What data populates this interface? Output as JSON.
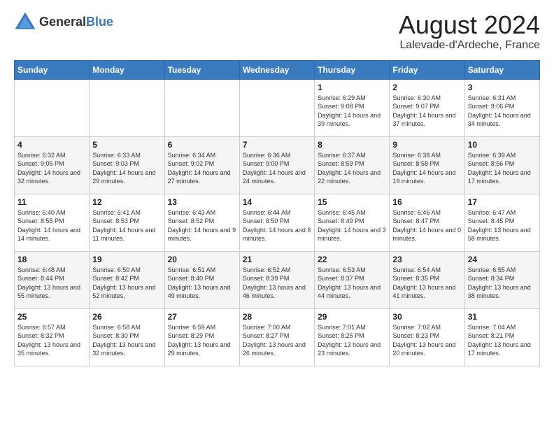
{
  "header": {
    "logo_general": "General",
    "logo_blue": "Blue",
    "month_year": "August 2024",
    "location": "Lalevade-d'Ardeche, France"
  },
  "weekdays": [
    "Sunday",
    "Monday",
    "Tuesday",
    "Wednesday",
    "Thursday",
    "Friday",
    "Saturday"
  ],
  "weeks": [
    [
      {
        "day": "",
        "info": ""
      },
      {
        "day": "",
        "info": ""
      },
      {
        "day": "",
        "info": ""
      },
      {
        "day": "",
        "info": ""
      },
      {
        "day": "1",
        "info": "Sunrise: 6:29 AM\nSunset: 9:08 PM\nDaylight: 14 hours\nand 39 minutes."
      },
      {
        "day": "2",
        "info": "Sunrise: 6:30 AM\nSunset: 9:07 PM\nDaylight: 14 hours\nand 37 minutes."
      },
      {
        "day": "3",
        "info": "Sunrise: 6:31 AM\nSunset: 9:06 PM\nDaylight: 14 hours\nand 34 minutes."
      }
    ],
    [
      {
        "day": "4",
        "info": "Sunrise: 6:32 AM\nSunset: 9:05 PM\nDaylight: 14 hours\nand 32 minutes."
      },
      {
        "day": "5",
        "info": "Sunrise: 6:33 AM\nSunset: 9:03 PM\nDaylight: 14 hours\nand 29 minutes."
      },
      {
        "day": "6",
        "info": "Sunrise: 6:34 AM\nSunset: 9:02 PM\nDaylight: 14 hours\nand 27 minutes."
      },
      {
        "day": "7",
        "info": "Sunrise: 6:36 AM\nSunset: 9:00 PM\nDaylight: 14 hours\nand 24 minutes."
      },
      {
        "day": "8",
        "info": "Sunrise: 6:37 AM\nSunset: 8:59 PM\nDaylight: 14 hours\nand 22 minutes."
      },
      {
        "day": "9",
        "info": "Sunrise: 6:38 AM\nSunset: 8:58 PM\nDaylight: 14 hours\nand 19 minutes."
      },
      {
        "day": "10",
        "info": "Sunrise: 6:39 AM\nSunset: 8:56 PM\nDaylight: 14 hours\nand 17 minutes."
      }
    ],
    [
      {
        "day": "11",
        "info": "Sunrise: 6:40 AM\nSunset: 8:55 PM\nDaylight: 14 hours\nand 14 minutes."
      },
      {
        "day": "12",
        "info": "Sunrise: 6:41 AM\nSunset: 8:53 PM\nDaylight: 14 hours\nand 11 minutes."
      },
      {
        "day": "13",
        "info": "Sunrise: 6:43 AM\nSunset: 8:52 PM\nDaylight: 14 hours\nand 9 minutes."
      },
      {
        "day": "14",
        "info": "Sunrise: 6:44 AM\nSunset: 8:50 PM\nDaylight: 14 hours\nand 6 minutes."
      },
      {
        "day": "15",
        "info": "Sunrise: 6:45 AM\nSunset: 8:49 PM\nDaylight: 14 hours\nand 3 minutes."
      },
      {
        "day": "16",
        "info": "Sunrise: 6:46 AM\nSunset: 8:47 PM\nDaylight: 14 hours\nand 0 minutes."
      },
      {
        "day": "17",
        "info": "Sunrise: 6:47 AM\nSunset: 8:45 PM\nDaylight: 13 hours\nand 58 minutes."
      }
    ],
    [
      {
        "day": "18",
        "info": "Sunrise: 6:48 AM\nSunset: 8:44 PM\nDaylight: 13 hours\nand 55 minutes."
      },
      {
        "day": "19",
        "info": "Sunrise: 6:50 AM\nSunset: 8:42 PM\nDaylight: 13 hours\nand 52 minutes."
      },
      {
        "day": "20",
        "info": "Sunrise: 6:51 AM\nSunset: 8:40 PM\nDaylight: 13 hours\nand 49 minutes."
      },
      {
        "day": "21",
        "info": "Sunrise: 6:52 AM\nSunset: 8:39 PM\nDaylight: 13 hours\nand 46 minutes."
      },
      {
        "day": "22",
        "info": "Sunrise: 6:53 AM\nSunset: 8:37 PM\nDaylight: 13 hours\nand 44 minutes."
      },
      {
        "day": "23",
        "info": "Sunrise: 6:54 AM\nSunset: 8:35 PM\nDaylight: 13 hours\nand 41 minutes."
      },
      {
        "day": "24",
        "info": "Sunrise: 6:55 AM\nSunset: 8:34 PM\nDaylight: 13 hours\nand 38 minutes."
      }
    ],
    [
      {
        "day": "25",
        "info": "Sunrise: 6:57 AM\nSunset: 8:32 PM\nDaylight: 13 hours\nand 35 minutes."
      },
      {
        "day": "26",
        "info": "Sunrise: 6:58 AM\nSunset: 8:30 PM\nDaylight: 13 hours\nand 32 minutes."
      },
      {
        "day": "27",
        "info": "Sunrise: 6:59 AM\nSunset: 8:29 PM\nDaylight: 13 hours\nand 29 minutes."
      },
      {
        "day": "28",
        "info": "Sunrise: 7:00 AM\nSunset: 8:27 PM\nDaylight: 13 hours\nand 26 minutes."
      },
      {
        "day": "29",
        "info": "Sunrise: 7:01 AM\nSunset: 8:25 PM\nDaylight: 13 hours\nand 23 minutes."
      },
      {
        "day": "30",
        "info": "Sunrise: 7:02 AM\nSunset: 8:23 PM\nDaylight: 13 hours\nand 20 minutes."
      },
      {
        "day": "31",
        "info": "Sunrise: 7:04 AM\nSunset: 8:21 PM\nDaylight: 13 hours\nand 17 minutes."
      }
    ]
  ]
}
